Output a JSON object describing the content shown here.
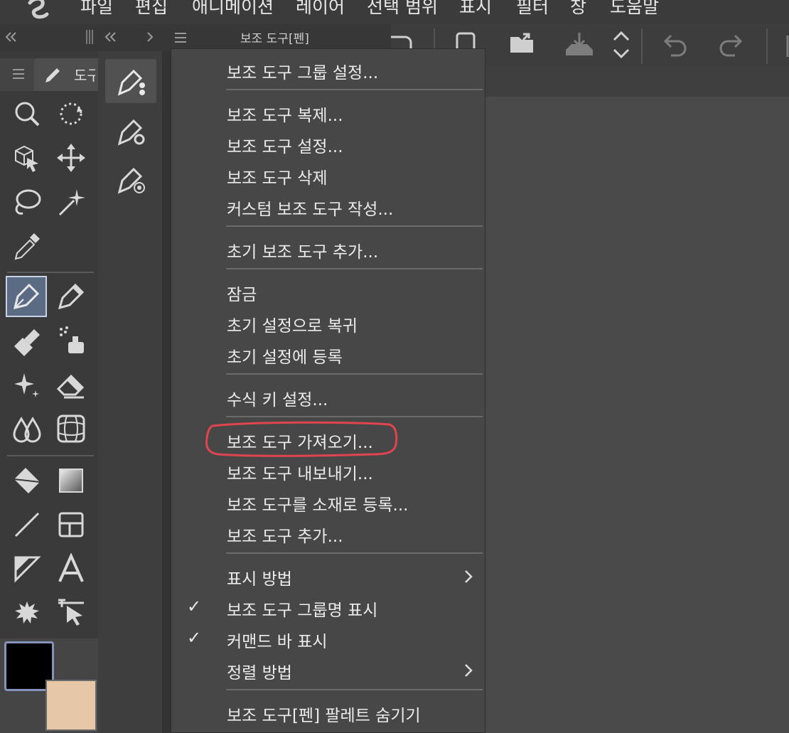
{
  "menubar": {
    "items": [
      "파일",
      "편집",
      "애니메이션",
      "레이어",
      "선택 범위",
      "표시",
      "필터",
      "창",
      "도움말"
    ]
  },
  "subtool_palette": {
    "title": "보조 도구[펜]"
  },
  "tool_panel": {
    "tab_label": "도구",
    "selected_tool": "pen"
  },
  "context_menu": {
    "items": [
      {
        "label": "보조 도구 그룹 설정..."
      },
      {
        "label": "보조 도구 복제..."
      },
      {
        "label": "보조 도구 설정..."
      },
      {
        "label": "보조 도구 삭제"
      },
      {
        "label": "커스텀 보조 도구 작성..."
      },
      {
        "label": "초기 보조 도구 추가..."
      },
      {
        "label": "잠금"
      },
      {
        "label": "초기 설정으로 복귀"
      },
      {
        "label": "초기 설정에 등록"
      },
      {
        "label": "수식 키 설정..."
      },
      {
        "label": "보조 도구 가져오기...",
        "highlighted": true
      },
      {
        "label": "보조 도구 내보내기..."
      },
      {
        "label": "보조 도구를 소재로 등록..."
      },
      {
        "label": "보조 도구 추가..."
      },
      {
        "label": "표시 방법",
        "submenu": true
      },
      {
        "label": "보조 도구 그룹명 표시",
        "checked": true
      },
      {
        "label": "커맨드 바 표시",
        "checked": true
      },
      {
        "label": "정렬 방법",
        "submenu": true
      },
      {
        "label": "보조 도구[펜] 팔레트 숨기기"
      }
    ],
    "check_glyph": "✓"
  },
  "colors": {
    "main_color": "#000000",
    "sub_color": "#e6c7a8",
    "highlight_ring": "#e0454f",
    "selected_tool_bg": "#5b6b84"
  }
}
